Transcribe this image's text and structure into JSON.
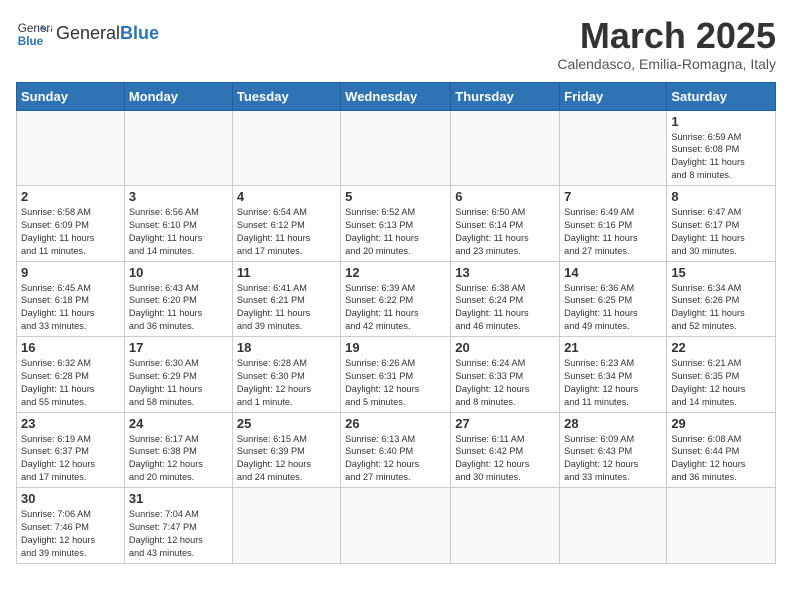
{
  "logo": {
    "text_general": "General",
    "text_blue": "Blue"
  },
  "title": "March 2025",
  "subtitle": "Calendasco, Emilia-Romagna, Italy",
  "weekdays": [
    "Sunday",
    "Monday",
    "Tuesday",
    "Wednesday",
    "Thursday",
    "Friday",
    "Saturday"
  ],
  "days": [
    {
      "num": "",
      "info": ""
    },
    {
      "num": "",
      "info": ""
    },
    {
      "num": "",
      "info": ""
    },
    {
      "num": "",
      "info": ""
    },
    {
      "num": "",
      "info": ""
    },
    {
      "num": "",
      "info": ""
    },
    {
      "num": "1",
      "info": "Sunrise: 6:59 AM\nSunset: 6:08 PM\nDaylight: 11 hours\nand 8 minutes."
    },
    {
      "num": "2",
      "info": "Sunrise: 6:58 AM\nSunset: 6:09 PM\nDaylight: 11 hours\nand 11 minutes."
    },
    {
      "num": "3",
      "info": "Sunrise: 6:56 AM\nSunset: 6:10 PM\nDaylight: 11 hours\nand 14 minutes."
    },
    {
      "num": "4",
      "info": "Sunrise: 6:54 AM\nSunset: 6:12 PM\nDaylight: 11 hours\nand 17 minutes."
    },
    {
      "num": "5",
      "info": "Sunrise: 6:52 AM\nSunset: 6:13 PM\nDaylight: 11 hours\nand 20 minutes."
    },
    {
      "num": "6",
      "info": "Sunrise: 6:50 AM\nSunset: 6:14 PM\nDaylight: 11 hours\nand 23 minutes."
    },
    {
      "num": "7",
      "info": "Sunrise: 6:49 AM\nSunset: 6:16 PM\nDaylight: 11 hours\nand 27 minutes."
    },
    {
      "num": "8",
      "info": "Sunrise: 6:47 AM\nSunset: 6:17 PM\nDaylight: 11 hours\nand 30 minutes."
    },
    {
      "num": "9",
      "info": "Sunrise: 6:45 AM\nSunset: 6:18 PM\nDaylight: 11 hours\nand 33 minutes."
    },
    {
      "num": "10",
      "info": "Sunrise: 6:43 AM\nSunset: 6:20 PM\nDaylight: 11 hours\nand 36 minutes."
    },
    {
      "num": "11",
      "info": "Sunrise: 6:41 AM\nSunset: 6:21 PM\nDaylight: 11 hours\nand 39 minutes."
    },
    {
      "num": "12",
      "info": "Sunrise: 6:39 AM\nSunset: 6:22 PM\nDaylight: 11 hours\nand 42 minutes."
    },
    {
      "num": "13",
      "info": "Sunrise: 6:38 AM\nSunset: 6:24 PM\nDaylight: 11 hours\nand 46 minutes."
    },
    {
      "num": "14",
      "info": "Sunrise: 6:36 AM\nSunset: 6:25 PM\nDaylight: 11 hours\nand 49 minutes."
    },
    {
      "num": "15",
      "info": "Sunrise: 6:34 AM\nSunset: 6:26 PM\nDaylight: 11 hours\nand 52 minutes."
    },
    {
      "num": "16",
      "info": "Sunrise: 6:32 AM\nSunset: 6:28 PM\nDaylight: 11 hours\nand 55 minutes."
    },
    {
      "num": "17",
      "info": "Sunrise: 6:30 AM\nSunset: 6:29 PM\nDaylight: 11 hours\nand 58 minutes."
    },
    {
      "num": "18",
      "info": "Sunrise: 6:28 AM\nSunset: 6:30 PM\nDaylight: 12 hours\nand 1 minute."
    },
    {
      "num": "19",
      "info": "Sunrise: 6:26 AM\nSunset: 6:31 PM\nDaylight: 12 hours\nand 5 minutes."
    },
    {
      "num": "20",
      "info": "Sunrise: 6:24 AM\nSunset: 6:33 PM\nDaylight: 12 hours\nand 8 minutes."
    },
    {
      "num": "21",
      "info": "Sunrise: 6:23 AM\nSunset: 6:34 PM\nDaylight: 12 hours\nand 11 minutes."
    },
    {
      "num": "22",
      "info": "Sunrise: 6:21 AM\nSunset: 6:35 PM\nDaylight: 12 hours\nand 14 minutes."
    },
    {
      "num": "23",
      "info": "Sunrise: 6:19 AM\nSunset: 6:37 PM\nDaylight: 12 hours\nand 17 minutes."
    },
    {
      "num": "24",
      "info": "Sunrise: 6:17 AM\nSunset: 6:38 PM\nDaylight: 12 hours\nand 20 minutes."
    },
    {
      "num": "25",
      "info": "Sunrise: 6:15 AM\nSunset: 6:39 PM\nDaylight: 12 hours\nand 24 minutes."
    },
    {
      "num": "26",
      "info": "Sunrise: 6:13 AM\nSunset: 6:40 PM\nDaylight: 12 hours\nand 27 minutes."
    },
    {
      "num": "27",
      "info": "Sunrise: 6:11 AM\nSunset: 6:42 PM\nDaylight: 12 hours\nand 30 minutes."
    },
    {
      "num": "28",
      "info": "Sunrise: 6:09 AM\nSunset: 6:43 PM\nDaylight: 12 hours\nand 33 minutes."
    },
    {
      "num": "29",
      "info": "Sunrise: 6:08 AM\nSunset: 6:44 PM\nDaylight: 12 hours\nand 36 minutes."
    },
    {
      "num": "30",
      "info": "Sunrise: 7:06 AM\nSunset: 7:46 PM\nDaylight: 12 hours\nand 39 minutes."
    },
    {
      "num": "31",
      "info": "Sunrise: 7:04 AM\nSunset: 7:47 PM\nDaylight: 12 hours\nand 43 minutes."
    },
    {
      "num": "",
      "info": ""
    },
    {
      "num": "",
      "info": ""
    },
    {
      "num": "",
      "info": ""
    },
    {
      "num": "",
      "info": ""
    },
    {
      "num": "",
      "info": ""
    }
  ]
}
